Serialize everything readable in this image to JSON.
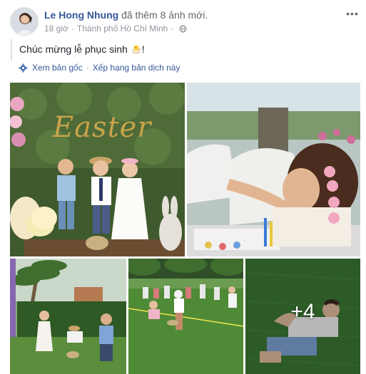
{
  "post": {
    "author": "Le Hong Nhung",
    "action": " đã thêm 8 ảnh mới.",
    "time": "18 giờ",
    "location": "Thành phố Hồ Chí Minh",
    "text_before_emoji": "Chúc mừng lễ phục sinh ",
    "text_after_emoji": "!",
    "emoji": "hatching-chick-icon"
  },
  "translate": {
    "see_original": "Xem bản gốc",
    "separator": "·",
    "rate_translation": "Xếp hạng bản dịch này"
  },
  "photos": {
    "banner_text": "Easter",
    "more_count": "+4"
  },
  "colors": {
    "link": "#365899",
    "meta": "#90949c",
    "gold": "#c9a34a"
  }
}
